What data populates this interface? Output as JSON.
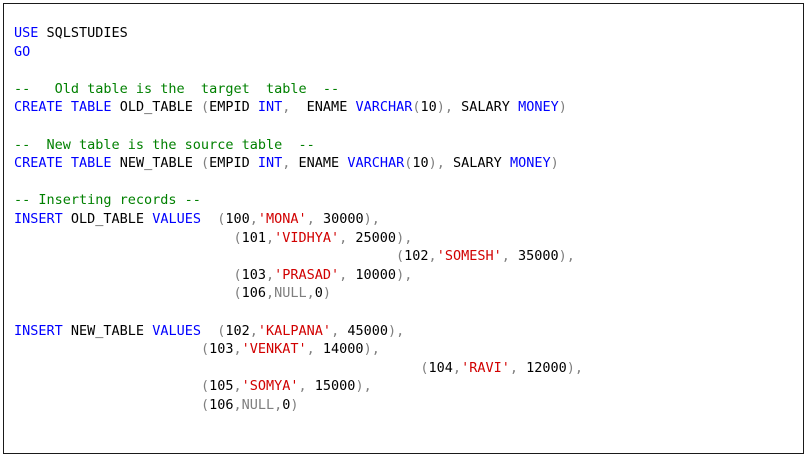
{
  "colors": {
    "keyword": "#0000ff",
    "string": "#d10000",
    "comment": "#008000",
    "punct": "#7f7f7f",
    "text": "#000000"
  },
  "lines": [
    [
      {
        "t": "USE",
        "c": "kw"
      },
      {
        "t": " SQLSTUDIES",
        "c": "plain"
      }
    ],
    [
      {
        "t": "GO",
        "c": "kw"
      }
    ],
    [],
    [
      {
        "t": "--   Old table is the  target  table  --",
        "c": "cmt"
      }
    ],
    [
      {
        "t": "CREATE",
        "c": "kw"
      },
      {
        "t": " ",
        "c": "plain"
      },
      {
        "t": "TABLE",
        "c": "kw"
      },
      {
        "t": " OLD_TABLE ",
        "c": "plain"
      },
      {
        "t": "(",
        "c": "gray"
      },
      {
        "t": "EMPID ",
        "c": "plain"
      },
      {
        "t": "INT",
        "c": "kw"
      },
      {
        "t": ",",
        "c": "gray"
      },
      {
        "t": "  ENAME ",
        "c": "plain"
      },
      {
        "t": "VARCHAR",
        "c": "kw"
      },
      {
        "t": "(",
        "c": "gray"
      },
      {
        "t": "10",
        "c": "plain"
      },
      {
        "t": "),",
        "c": "gray"
      },
      {
        "t": " SALARY ",
        "c": "plain"
      },
      {
        "t": "MONEY",
        "c": "kw"
      },
      {
        "t": ")",
        "c": "gray"
      }
    ],
    [],
    [
      {
        "t": "--  New table is the source table  --",
        "c": "cmt"
      }
    ],
    [
      {
        "t": "CREATE",
        "c": "kw"
      },
      {
        "t": " ",
        "c": "plain"
      },
      {
        "t": "TABLE",
        "c": "kw"
      },
      {
        "t": " NEW_TABLE ",
        "c": "plain"
      },
      {
        "t": "(",
        "c": "gray"
      },
      {
        "t": "EMPID ",
        "c": "plain"
      },
      {
        "t": "INT",
        "c": "kw"
      },
      {
        "t": ",",
        "c": "gray"
      },
      {
        "t": " ENAME ",
        "c": "plain"
      },
      {
        "t": "VARCHAR",
        "c": "kw"
      },
      {
        "t": "(",
        "c": "gray"
      },
      {
        "t": "10",
        "c": "plain"
      },
      {
        "t": "),",
        "c": "gray"
      },
      {
        "t": " SALARY ",
        "c": "plain"
      },
      {
        "t": "MONEY",
        "c": "kw"
      },
      {
        "t": ")",
        "c": "gray"
      }
    ],
    [],
    [
      {
        "t": "-- Inserting records --",
        "c": "cmt"
      }
    ],
    [
      {
        "t": "INSERT",
        "c": "kw"
      },
      {
        "t": " OLD_TABLE ",
        "c": "plain"
      },
      {
        "t": "VALUES",
        "c": "kw"
      },
      {
        "t": "  ",
        "c": "plain"
      },
      {
        "t": "(",
        "c": "gray"
      },
      {
        "t": "100",
        "c": "plain"
      },
      {
        "t": ",",
        "c": "gray"
      },
      {
        "t": "'MONA'",
        "c": "str"
      },
      {
        "t": ",",
        "c": "gray"
      },
      {
        "t": " 30000",
        "c": "plain"
      },
      {
        "t": "),",
        "c": "gray"
      }
    ],
    [
      {
        "t": "                           ",
        "c": "plain"
      },
      {
        "t": "(",
        "c": "gray"
      },
      {
        "t": "101",
        "c": "plain"
      },
      {
        "t": ",",
        "c": "gray"
      },
      {
        "t": "'VIDHYA'",
        "c": "str"
      },
      {
        "t": ",",
        "c": "gray"
      },
      {
        "t": " 25000",
        "c": "plain"
      },
      {
        "t": "),",
        "c": "gray"
      }
    ],
    [
      {
        "t": "                                               ",
        "c": "plain"
      },
      {
        "t": "(",
        "c": "gray"
      },
      {
        "t": "102",
        "c": "plain"
      },
      {
        "t": ",",
        "c": "gray"
      },
      {
        "t": "'SOMESH'",
        "c": "str"
      },
      {
        "t": ",",
        "c": "gray"
      },
      {
        "t": " 35000",
        "c": "plain"
      },
      {
        "t": "),",
        "c": "gray"
      }
    ],
    [
      {
        "t": "                           ",
        "c": "plain"
      },
      {
        "t": "(",
        "c": "gray"
      },
      {
        "t": "103",
        "c": "plain"
      },
      {
        "t": ",",
        "c": "gray"
      },
      {
        "t": "'PRASAD'",
        "c": "str"
      },
      {
        "t": ",",
        "c": "gray"
      },
      {
        "t": " 10000",
        "c": "plain"
      },
      {
        "t": "),",
        "c": "gray"
      }
    ],
    [
      {
        "t": "                           ",
        "c": "plain"
      },
      {
        "t": "(",
        "c": "gray"
      },
      {
        "t": "106",
        "c": "plain"
      },
      {
        "t": ",",
        "c": "gray"
      },
      {
        "t": "NULL",
        "c": "gray"
      },
      {
        "t": ",",
        "c": "gray"
      },
      {
        "t": "0",
        "c": "plain"
      },
      {
        "t": ")",
        "c": "gray"
      }
    ],
    [],
    [
      {
        "t": "INSERT",
        "c": "kw"
      },
      {
        "t": " NEW_TABLE ",
        "c": "plain"
      },
      {
        "t": "VALUES",
        "c": "kw"
      },
      {
        "t": "  ",
        "c": "plain"
      },
      {
        "t": "(",
        "c": "gray"
      },
      {
        "t": "102",
        "c": "plain"
      },
      {
        "t": ",",
        "c": "gray"
      },
      {
        "t": "'KALPANA'",
        "c": "str"
      },
      {
        "t": ",",
        "c": "gray"
      },
      {
        "t": " 45000",
        "c": "plain"
      },
      {
        "t": "),",
        "c": "gray"
      }
    ],
    [
      {
        "t": "                       ",
        "c": "plain"
      },
      {
        "t": "(",
        "c": "gray"
      },
      {
        "t": "103",
        "c": "plain"
      },
      {
        "t": ",",
        "c": "gray"
      },
      {
        "t": "'VENKAT'",
        "c": "str"
      },
      {
        "t": ",",
        "c": "gray"
      },
      {
        "t": " 14000",
        "c": "plain"
      },
      {
        "t": "),",
        "c": "gray"
      }
    ],
    [
      {
        "t": "                                                  ",
        "c": "plain"
      },
      {
        "t": "(",
        "c": "gray"
      },
      {
        "t": "104",
        "c": "plain"
      },
      {
        "t": ",",
        "c": "gray"
      },
      {
        "t": "'RAVI'",
        "c": "str"
      },
      {
        "t": ",",
        "c": "gray"
      },
      {
        "t": " 12000",
        "c": "plain"
      },
      {
        "t": "),",
        "c": "gray"
      }
    ],
    [
      {
        "t": "                       ",
        "c": "plain"
      },
      {
        "t": "(",
        "c": "gray"
      },
      {
        "t": "105",
        "c": "plain"
      },
      {
        "t": ",",
        "c": "gray"
      },
      {
        "t": "'SOMYA'",
        "c": "str"
      },
      {
        "t": ",",
        "c": "gray"
      },
      {
        "t": " 15000",
        "c": "plain"
      },
      {
        "t": "),",
        "c": "gray"
      }
    ],
    [
      {
        "t": "                       ",
        "c": "plain"
      },
      {
        "t": "(",
        "c": "gray"
      },
      {
        "t": "106",
        "c": "plain"
      },
      {
        "t": ",",
        "c": "gray"
      },
      {
        "t": "NULL",
        "c": "gray"
      },
      {
        "t": ",",
        "c": "gray"
      },
      {
        "t": "0",
        "c": "plain"
      },
      {
        "t": ")",
        "c": "gray"
      }
    ]
  ]
}
